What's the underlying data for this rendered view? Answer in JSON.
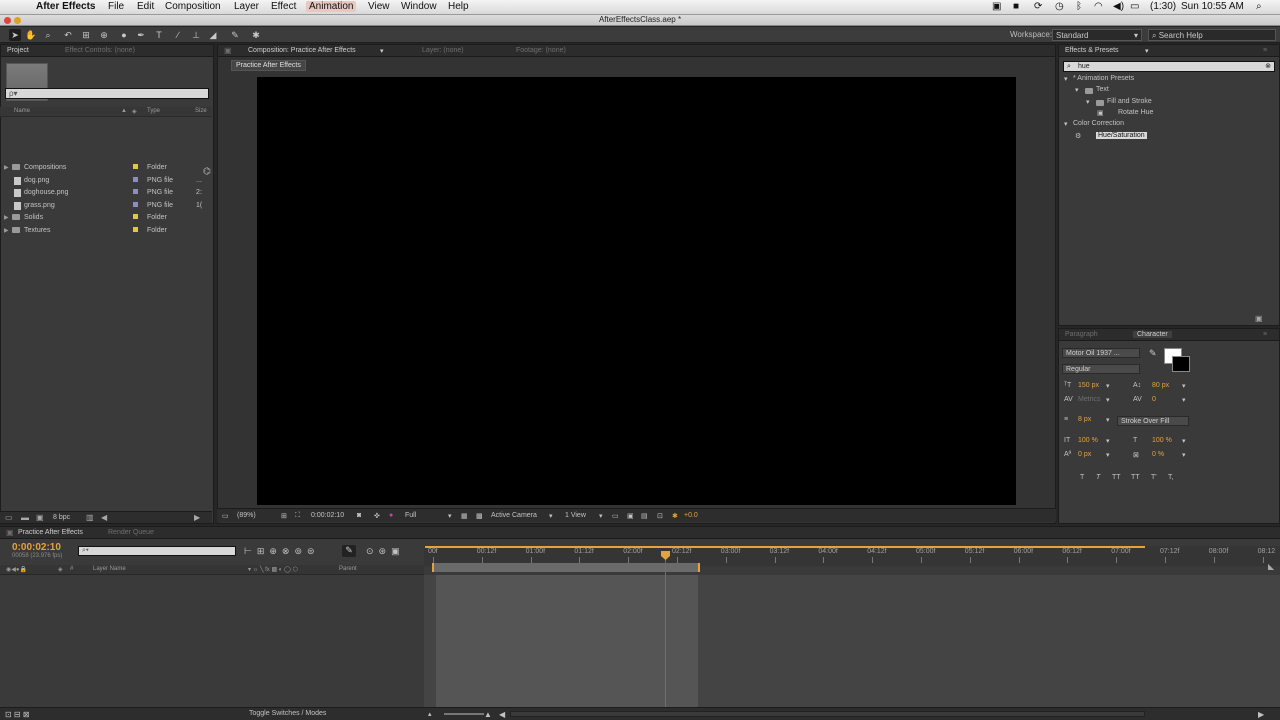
{
  "menubar": {
    "apple_glyph": "",
    "app_name": "After Effects",
    "items": [
      "File",
      "Edit",
      "Composition",
      "Layer",
      "Effect",
      "Animation",
      "View",
      "Window",
      "Help"
    ],
    "battery": "(1:30)",
    "clock": "Sun 10:55 AM"
  },
  "window": {
    "title": "AfterEffectsClass.aep *"
  },
  "toolbar": {
    "workspace_label": "Workspace:",
    "workspace_value": "Standard",
    "search_help": "Search Help"
  },
  "project_panel": {
    "tabs": [
      "Project",
      "Effect Controls: (none)"
    ],
    "search_placeholder": "ρ▾",
    "columns": [
      "Name",
      "Type",
      "Size"
    ],
    "items": [
      {
        "name": "Compositions",
        "type": "Folder",
        "size": "",
        "kind": "folder",
        "label_color": "#e8c63c"
      },
      {
        "name": "dog.png",
        "type": "PNG file",
        "size": "...",
        "kind": "file",
        "label_color": "#8e8cc4"
      },
      {
        "name": "doghouse.png",
        "type": "PNG file",
        "size": "2:",
        "kind": "file",
        "label_color": "#8e8cc4"
      },
      {
        "name": "grass.png",
        "type": "PNG file",
        "size": "1(",
        "kind": "file",
        "label_color": "#8e8cc4"
      },
      {
        "name": "Solids",
        "type": "Folder",
        "size": "",
        "kind": "folder",
        "label_color": "#e8c63c"
      },
      {
        "name": "Textures",
        "type": "Folder",
        "size": "",
        "kind": "folder",
        "label_color": "#e8c63c"
      }
    ],
    "footer_bpc": "8 bpc"
  },
  "comp_panel": {
    "tabs": [
      "Composition: Practice After Effects",
      "Layer: (none)",
      "Footage: (none)"
    ],
    "sub_tab": "Practice After Effects",
    "footer": {
      "zoom": "(89%)",
      "timecode": "0:00:02:10",
      "resolution": "Full",
      "camera": "Active Camera",
      "views": "1 View",
      "exposure": "+0.0"
    }
  },
  "effects_panel": {
    "title": "Effects & Presets",
    "search_value": "hue",
    "tree": [
      {
        "label": "* Animation Presets",
        "depth": 0
      },
      {
        "label": "Text",
        "depth": 1
      },
      {
        "label": "Fill and Stroke",
        "depth": 2
      },
      {
        "label": "Rotate Hue",
        "depth": 3
      },
      {
        "label": "Color Correction",
        "depth": 0
      },
      {
        "label": "Hue/Saturation",
        "depth": 1,
        "selected": true
      }
    ]
  },
  "character_panel": {
    "tabs": [
      "Paragraph",
      "Character"
    ],
    "font": "Motor Oil 1937 ...",
    "style": "Regular",
    "size": "150 px",
    "leading": "80 px",
    "kerning": "Metrics",
    "tracking": "0",
    "stroke_width": "8 px",
    "stroke_mode": "Stroke Over Fill",
    "vscale": "100 %",
    "hscale": "100 %",
    "baseline": "0 px",
    "tsume": "0 %",
    "style_buttons": [
      "T",
      "T",
      "TT",
      "TT",
      "T'",
      "T,"
    ]
  },
  "timeline": {
    "tabs": [
      "Practice After Effects",
      "Render Queue"
    ],
    "timecode": "0:00:02:10",
    "fps": "00058 (23.976 fps)",
    "layer_columns": [
      "#",
      "Layer Name",
      "Parent"
    ],
    "ruler_labels": [
      "00f",
      "00:12f",
      "01:00f",
      "01:12f",
      "02:00f",
      "02:12f",
      "03:00f",
      "03:12f",
      "04:00f",
      "04:12f",
      "05:00f",
      "05:12f",
      "06:00f",
      "06:12f",
      "07:00f",
      "07:12f",
      "08:00f",
      "08:12"
    ],
    "toggle_label": "Toggle Switches / Modes"
  },
  "colors": {
    "accent_orange": "#e3a33e",
    "cti_red": "#e0403a"
  }
}
